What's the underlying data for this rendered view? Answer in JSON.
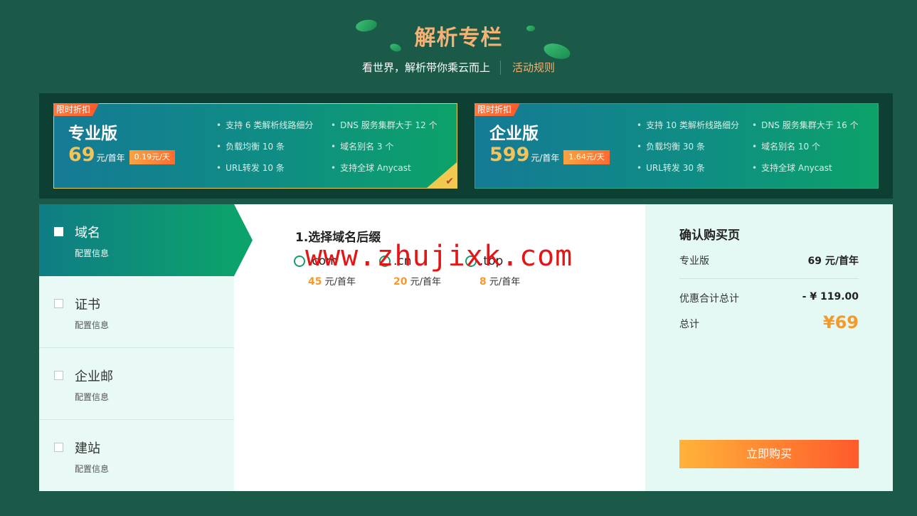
{
  "header": {
    "title": "解析专栏",
    "slogan": "看世界，解析带你乘云而上",
    "rules_link": "活动规则"
  },
  "plans": [
    {
      "tag": "限时折扣",
      "name": "专业版",
      "price": "69",
      "unit": "元/首年",
      "daily": "0.19元/天",
      "selected": true,
      "features": [
        "支持 6 类解析线路细分",
        "DNS 服务集群大于 12 个",
        "负载均衡 10 条",
        "域名别名 3 个",
        "URL转发 10 条",
        "支持全球 Anycast"
      ]
    },
    {
      "tag": "限时折扣",
      "name": "企业版",
      "price": "599",
      "unit": "元/首年",
      "daily": "1.64元/天",
      "selected": false,
      "features": [
        "支持 10 类解析线路细分",
        "DNS 服务集群大于 16 个",
        "负载均衡 30 条",
        "域名别名 10 个",
        "URL转发 30 条",
        "支持全球 Anycast"
      ]
    }
  ],
  "sidebar": {
    "items": [
      {
        "name": "域名",
        "info": "配置信息",
        "active": true
      },
      {
        "name": "证书",
        "info": "配置信息",
        "active": false
      },
      {
        "name": "企业邮",
        "info": "配置信息",
        "active": false
      },
      {
        "name": "建站",
        "info": "配置信息",
        "active": false
      }
    ]
  },
  "center": {
    "step_title": "1.选择域名后缀",
    "options": [
      {
        "suffix": ".com",
        "price": "45",
        "unit": "元/首年"
      },
      {
        "suffix": ".cn",
        "price": "20",
        "unit": "元/首年"
      },
      {
        "suffix": ".top",
        "price": "8",
        "unit": "元/首年"
      }
    ],
    "watermark": "www.zhujixk.com"
  },
  "summary": {
    "title": "确认购买页",
    "plan_label": "专业版",
    "plan_price": "69 元/首年",
    "discount_label": "优惠合计总计",
    "discount_value": "- ¥ 119.00",
    "total_label": "总计",
    "total_value": "¥69",
    "buy_label": "立即购买"
  },
  "colors": {
    "background": "#1b5a49",
    "accent_orange": "#f39a2b",
    "title_gold": "#f6b274"
  }
}
